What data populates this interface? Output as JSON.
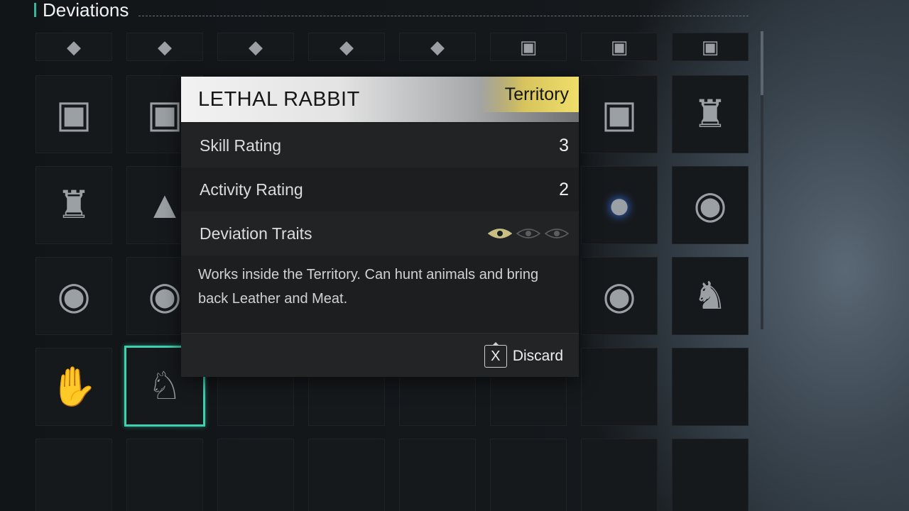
{
  "header": {
    "title": "Deviations"
  },
  "inventory": {
    "top_row": [
      {
        "icon": "cargo-board-icon"
      },
      {
        "icon": "cargo-board-icon"
      },
      {
        "icon": "cargo-board-icon"
      },
      {
        "icon": "cargo-board-icon"
      },
      {
        "icon": "cargo-board-icon"
      },
      {
        "icon": "golem-icon"
      },
      {
        "icon": "golem-icon"
      },
      {
        "icon": "golem-icon"
      }
    ],
    "rows": [
      [
        "golem-icon",
        "golem-icon",
        "",
        "",
        "",
        "",
        "golem-icon",
        "samurai-armor-icon"
      ],
      [
        "samurai-armor-icon",
        "raincoat-child-icon",
        "",
        "",
        "",
        "",
        "energy-orb-icon",
        "red-mask-doll-icon"
      ],
      [
        "red-mask-doll-icon",
        "red-mask-doll-icon",
        "",
        "",
        "",
        "",
        "red-mask-doll-icon",
        "striped-cat-icon"
      ],
      [
        "mechanical-hand-icon",
        "rabbit-icon",
        "empty",
        "empty",
        "empty",
        "empty",
        "empty",
        "empty"
      ],
      [
        "empty",
        "empty",
        "empty",
        "empty",
        "empty",
        "empty",
        "empty",
        "empty"
      ]
    ],
    "selected_item": "rabbit-icon"
  },
  "popup": {
    "name": "LETHAL RABBIT",
    "tag": "Territory",
    "skill_label": "Skill Rating",
    "skill_value": "3",
    "activity_label": "Activity Rating",
    "activity_value": "2",
    "traits_label": "Deviation Traits",
    "traits_active": 1,
    "traits_total": 3,
    "description": "Works inside the Territory. Can hunt animals and bring back Leather and Meat.",
    "discard_key": "X",
    "discard_label": "Discard"
  },
  "colors": {
    "accent": "#39b59a",
    "selection": "#3fd0b0",
    "tag": "#e8d464",
    "trait_active": "#c9bf84",
    "trait_inactive": "#5a5d60"
  }
}
